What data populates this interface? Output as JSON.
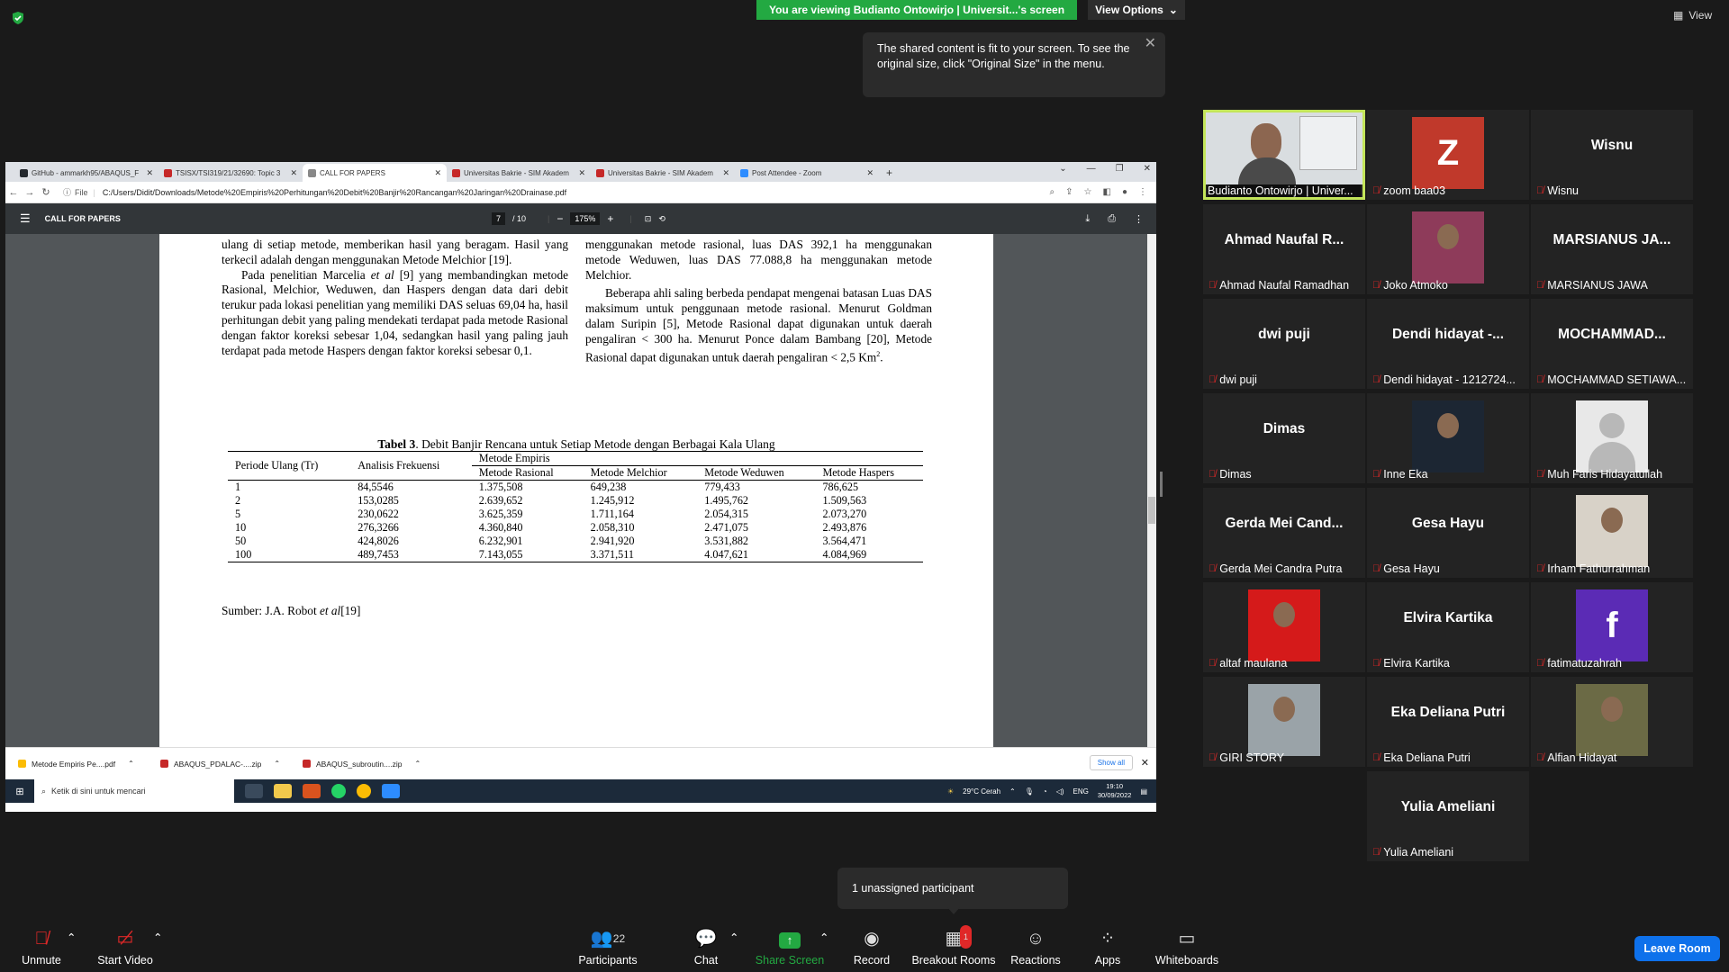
{
  "top": {
    "viewing_banner": "You are viewing Budianto Ontowirjo | Universit...'s screen",
    "view_options": "View Options",
    "view_label": "View",
    "tooltip": "The shared content is fit to your screen. To see the original size, click \"Original Size\" in the menu."
  },
  "browser": {
    "tabs": [
      {
        "label": "GitHub - ammarkh95/ABAQUS_F",
        "color": "#24292e"
      },
      {
        "label": "TSISX/TSI319/21/32690: Topic 3",
        "color": "#c62828"
      },
      {
        "label": "CALL FOR PAPERS",
        "color": "#888888"
      },
      {
        "label": "Universitas Bakrie - SIM Akadem",
        "color": "#c62828"
      },
      {
        "label": "Universitas Bakrie - SIM Akadem",
        "color": "#c62828"
      },
      {
        "label": "Post Attendee - Zoom",
        "color": "#2d8cff"
      }
    ],
    "url_prefix": "File",
    "url": "C:/Users/Didit/Downloads/Metode%20Empiris%20Perhitungan%20Debit%20Banjir%20Rancangan%20Jaringan%20Drainase.pdf"
  },
  "pdf": {
    "title": "CALL FOR PAPERS",
    "page_current": "7",
    "page_total": "/ 10",
    "zoom": "175%",
    "left_col": {
      "p1": "ulang di setiap metode, memberikan hasil yang beragam. Hasil yang terkecil adalah dengan menggunakan Metode Melchior [19].",
      "p2_a": "Pada penelitian Marcelia ",
      "p2_em": "et al",
      "p2_b": " [9] yang membandingkan metode Rasional, Melchior, Weduwen, dan Haspers dengan data dari debit terukur pada lokasi penelitian yang memiliki DAS seluas 69,04 ha, hasil perhitungan debit yang paling mendekati terdapat pada metode Rasional dengan faktor koreksi sebesar 1,04, sedangkan hasil yang paling jauh terdapat pada metode Haspers dengan faktor koreksi sebesar 0,1."
    },
    "right_col": {
      "p1": "menggunakan metode rasional, luas DAS 392,1 ha menggunakan metode Weduwen, luas DAS 77.088,8 ha menggunakan metode Melchior.",
      "p2": "Beberapa ahli saling berbeda pendapat mengenai batasan Luas DAS maksimum untuk penggunaan metode rasional. Menurut Goldman dalam Suripin [5], Metode Rasional dapat digunakan untuk daerah pengaliran < 300 ha. Menurut Ponce dalam Bambang [20], Metode Rasional dapat digunakan untuk daerah pengaliran < 2,5 Km",
      "p2_sup": "2",
      "p2_end": "."
    },
    "table": {
      "title_bold": "Tabel 3",
      "title_rest": ". Debit Banjir Rencana untuk Setiap Metode dengan Berbagai Kala Ulang",
      "h_periode": "Periode Ulang (Tr)",
      "h_frek": "Analisis Frekuensi",
      "h_empiris": "Metode Empiris",
      "h_rasional": "Metode Rasional",
      "h_melchior": "Metode Melchior",
      "h_weduwen": "Metode Weduwen",
      "h_haspers": "Metode Haspers",
      "rows": [
        [
          "1",
          "84,5546",
          "1.375,508",
          "649,238",
          "779,433",
          "786,625"
        ],
        [
          "2",
          "153,0285",
          "2.639,652",
          "1.245,912",
          "1.495,762",
          "1.509,563"
        ],
        [
          "5",
          "230,0622",
          "3.625,359",
          "1.711,164",
          "2.054,315",
          "2.073,270"
        ],
        [
          "10",
          "276,3266",
          "4.360,840",
          "2.058,310",
          "2.471,075",
          "2.493,876"
        ],
        [
          "50",
          "424,8026",
          "6.232,901",
          "2.941,920",
          "3.531,882",
          "3.564,471"
        ],
        [
          "100",
          "489,7453",
          "7.143,055",
          "3.371,511",
          "4.047,621",
          "4.084,969"
        ]
      ],
      "source_a": "Sumber: J.A. Robot ",
      "source_em": "et al",
      "source_b": "[19]"
    }
  },
  "downloads": {
    "items": [
      "Metode Empiris Pe....pdf",
      "ABAQUS_PDALAC-....zip",
      "ABAQUS_subroutin....zip"
    ],
    "show_all": "Show all"
  },
  "taskbar": {
    "search_placeholder": "Ketik di sini untuk mencari",
    "weather": "29°C  Cerah",
    "lang": "ENG",
    "time": "19:10",
    "date": "30/09/2022"
  },
  "gallery": [
    {
      "name": "Budianto Ontowirjo | Univer...",
      "big": "",
      "type": "video"
    },
    {
      "name": "zoom baa03",
      "big": "Z",
      "type": "letter",
      "color": "#c0392b"
    },
    {
      "name": "Wisnu",
      "big": "Wisnu",
      "type": "text"
    },
    {
      "name": "Ahmad Naufal Ramadhan",
      "big": "Ahmad Naufal R...",
      "type": "text"
    },
    {
      "name": "Joko Atmoko",
      "big": "",
      "type": "photo",
      "color": "#8e3b5a"
    },
    {
      "name": "MARSIANUS JAWA",
      "big": "MARSIANUS JA...",
      "type": "text"
    },
    {
      "name": "dwi puji",
      "big": "dwi puji",
      "type": "text"
    },
    {
      "name": "Dendi hidayat - 1212724...",
      "big": "Dendi hidayat -...",
      "type": "text"
    },
    {
      "name": "MOCHAMMAD SETIAWA...",
      "big": "MOCHAMMAD...",
      "type": "text"
    },
    {
      "name": "Dimas",
      "big": "Dimas",
      "type": "text"
    },
    {
      "name": "Inne Eka",
      "big": "",
      "type": "photo",
      "color": "#1c2633"
    },
    {
      "name": "Muh Faris Hidayatullah",
      "big": "",
      "type": "default"
    },
    {
      "name": "Gerda Mei Candra Putra",
      "big": "Gerda Mei Cand...",
      "type": "text"
    },
    {
      "name": "Gesa Hayu",
      "big": "Gesa Hayu",
      "type": "text"
    },
    {
      "name": "Irham Fathurrahman",
      "big": "",
      "type": "photo",
      "color": "#d8d2c8"
    },
    {
      "name": "altaf maulana",
      "big": "",
      "type": "photo",
      "color": "#d51a1a"
    },
    {
      "name": "Elvira Kartika",
      "big": "Elvira Kartika",
      "type": "text"
    },
    {
      "name": "fatimatuzahrah",
      "big": "f",
      "type": "letter",
      "color": "#5b2bb5"
    },
    {
      "name": "GIRI STORY",
      "big": "",
      "type": "photo",
      "color": "#9aa3a8"
    },
    {
      "name": "Eka Deliana Putri",
      "big": "Eka Deliana Putri",
      "type": "text"
    },
    {
      "name": "Alfian Hidayat",
      "big": "",
      "type": "photo",
      "color": "#6b6a45"
    },
    {
      "name": "Yulia Ameliani",
      "big": "Yulia Ameliani",
      "type": "text"
    }
  ],
  "unassigned": "1 unassigned participant",
  "bottom": {
    "unmute": "Unmute",
    "start_video": "Start Video",
    "participants": "Participants",
    "participants_count": "22",
    "chat": "Chat",
    "share_screen": "Share Screen",
    "record": "Record",
    "breakout_rooms": "Breakout Rooms",
    "breakout_badge": "1",
    "reactions": "Reactions",
    "apps": "Apps",
    "whiteboards": "Whiteboards",
    "leave_room": "Leave Room"
  },
  "colors": {
    "zoom_green": "#23a942",
    "leave_blue": "#0e71eb",
    "mute_red": "#e02828"
  }
}
